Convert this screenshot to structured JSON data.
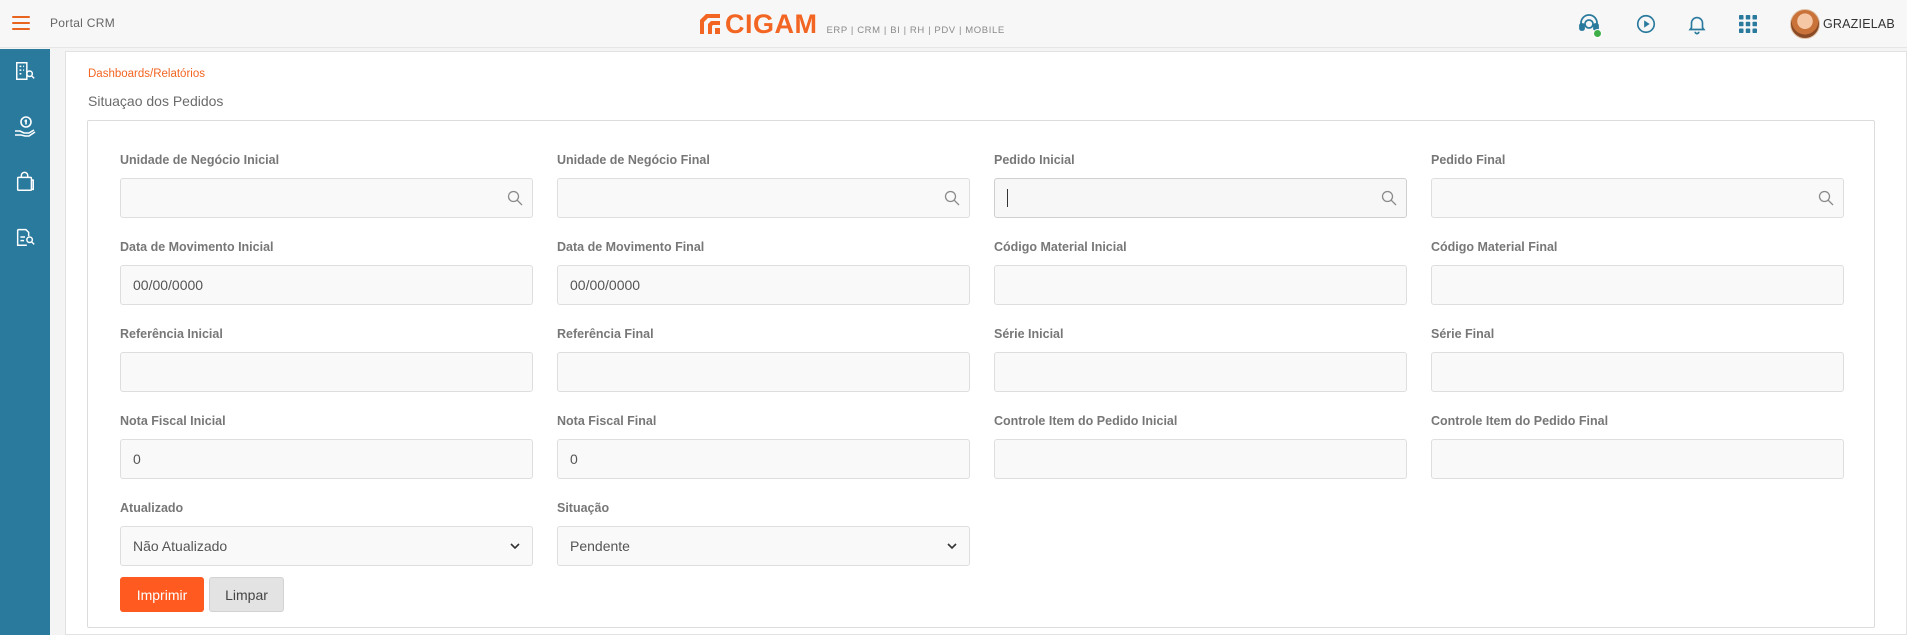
{
  "header": {
    "portal_title": "Portal CRM",
    "logo_text": "CIGAM",
    "logo_sub": "ERP | CRM | BI | RH | PDV | MOBILE",
    "user_name": "GRAZIELAB",
    "icons": [
      "support-agent-icon",
      "play-circle-icon",
      "bell-icon",
      "apps-grid-icon"
    ],
    "status_color": "#3fae49"
  },
  "sidebar": {
    "icons": [
      "building-search-icon",
      "money-hand-icon",
      "shopping-bag-icon",
      "document-search-icon"
    ],
    "color": "#2a7a9e"
  },
  "breadcrumb": "Dashboards/Relatórios",
  "page_title": "Situaçao dos Pedidos",
  "form": {
    "unidade_negocio_inicial": {
      "label": "Unidade de Negócio Inicial",
      "value": ""
    },
    "unidade_negocio_final": {
      "label": "Unidade de Negócio Final",
      "value": ""
    },
    "pedido_inicial": {
      "label": "Pedido Inicial",
      "value": ""
    },
    "pedido_final": {
      "label": "Pedido Final",
      "value": ""
    },
    "data_movimento_inicial": {
      "label": "Data de Movimento Inicial",
      "value": "00/00/0000"
    },
    "data_movimento_final": {
      "label": "Data de Movimento Final",
      "value": "00/00/0000"
    },
    "codigo_material_inicial": {
      "label": "Código Material Inicial",
      "value": ""
    },
    "codigo_material_final": {
      "label": "Código Material Final",
      "value": ""
    },
    "referencia_inicial": {
      "label": "Referência Inicial",
      "value": ""
    },
    "referencia_final": {
      "label": "Referência Final",
      "value": ""
    },
    "serie_inicial": {
      "label": "Série Inicial",
      "value": ""
    },
    "serie_final": {
      "label": "Série Final",
      "value": ""
    },
    "nota_fiscal_inicial": {
      "label": "Nota Fiscal Inicial",
      "value": "0"
    },
    "nota_fiscal_final": {
      "label": "Nota Fiscal Final",
      "value": "0"
    },
    "controle_item_inicial": {
      "label": "Controle Item do Pedido Inicial",
      "value": ""
    },
    "controle_item_final": {
      "label": "Controle Item do Pedido Final",
      "value": ""
    },
    "atualizado": {
      "label": "Atualizado",
      "selected": "Não Atualizado"
    },
    "situacao": {
      "label": "Situação",
      "selected": "Pendente"
    }
  },
  "buttons": {
    "print_label": "Imprimir",
    "clear_label": "Limpar",
    "primary_color": "#ff5a1f"
  }
}
